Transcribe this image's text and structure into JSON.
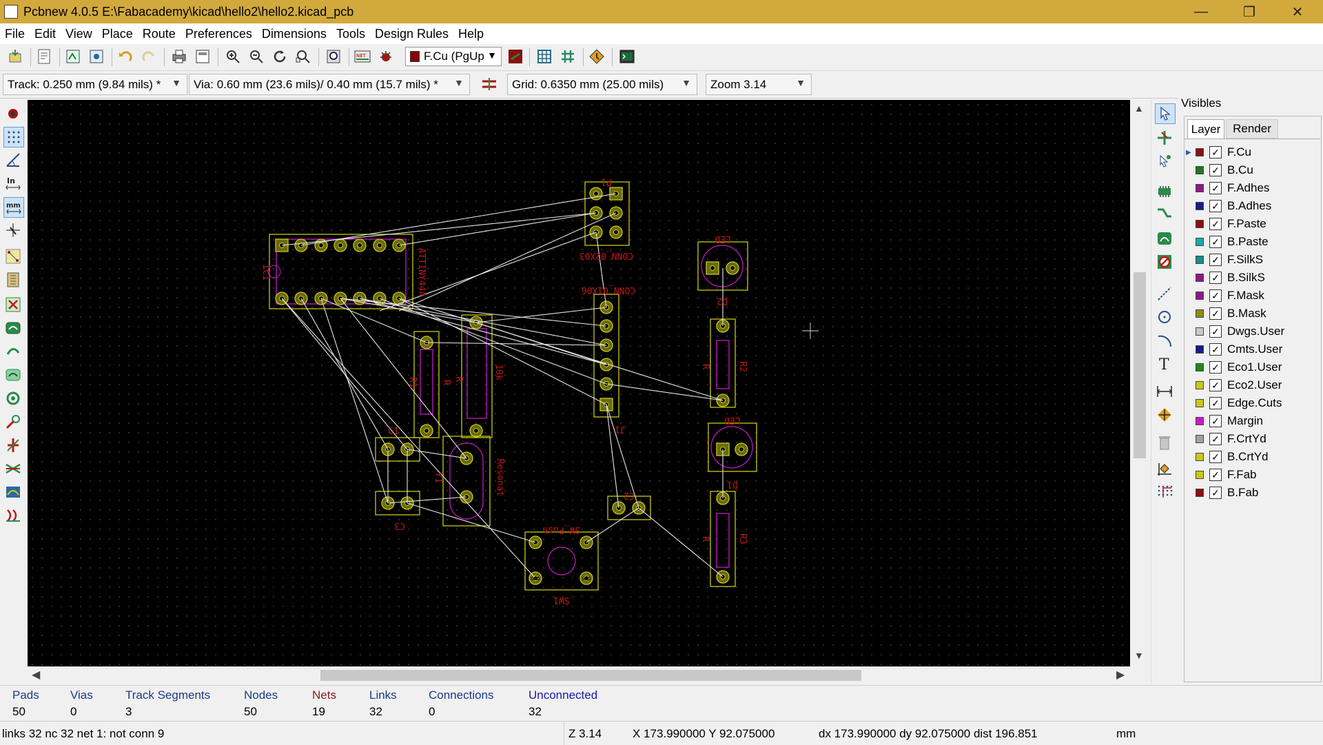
{
  "window": {
    "title": "Pcbnew 4.0.5 E:\\Fabacademy\\kicad\\hello2\\hello2.kicad_pcb",
    "minimize": "—",
    "maximize": "❐",
    "close": "✕"
  },
  "menu": [
    "File",
    "Edit",
    "View",
    "Place",
    "Route",
    "Preferences",
    "Dimensions",
    "Tools",
    "Design Rules",
    "Help"
  ],
  "toolbar": {
    "layer_select": "F.Cu (PgUp"
  },
  "auxbar": {
    "track": "Track: 0.250 mm (9.84 mils) *",
    "via": "Via: 0.60 mm (23.6 mils)/ 0.40 mm (15.7 mils) *",
    "grid": "Grid: 0.6350 mm (25.00 mils)",
    "zoom": "Zoom 3.14"
  },
  "canvas": {
    "refs": {
      "P1": "P1",
      "conn2x03": "CONN_02X03",
      "conn1x06": "CONN_01X06",
      "IC1": "IC1",
      "attiny": "ATTINY44A",
      "LED_top": "LED",
      "D2": "D2",
      "R2": "R2",
      "R_top": "R",
      "R1": "R1",
      "R_left": "R",
      "R_mid": "R",
      "R4": "10k",
      "LED_bot": "LED",
      "D1": "D1",
      "R3": "R3",
      "R_bot": "R",
      "C1": "C1",
      "C2": "C2",
      "C3": "C3",
      "Y1": "Y1",
      "resonator": "Resonat",
      "sw_push": "SW_Push",
      "SW1": "SW1",
      "J1": "J1",
      "GND1": "GND",
      "GND2": "GND"
    }
  },
  "visibles": {
    "title": "Visibles",
    "tabs": [
      "Layer",
      "Render"
    ],
    "layers": [
      {
        "name": "F.Cu",
        "color": "#8b1010"
      },
      {
        "name": "B.Cu",
        "color": "#1a7a1a"
      },
      {
        "name": "F.Adhes",
        "color": "#8b1a8b"
      },
      {
        "name": "B.Adhes",
        "color": "#1a1a8b"
      },
      {
        "name": "F.Paste",
        "color": "#8b1010"
      },
      {
        "name": "B.Paste",
        "color": "#1aaaaa"
      },
      {
        "name": "F.SilkS",
        "color": "#1a8b8b"
      },
      {
        "name": "B.SilkS",
        "color": "#8b1a8b"
      },
      {
        "name": "F.Mask",
        "color": "#8b1a8b"
      },
      {
        "name": "B.Mask",
        "color": "#8b8b1a"
      },
      {
        "name": "Dwgs.User",
        "color": "#c8c8c8"
      },
      {
        "name": "Cmts.User",
        "color": "#1a1a8b"
      },
      {
        "name": "Eco1.User",
        "color": "#1a8b1a"
      },
      {
        "name": "Eco2.User",
        "color": "#c8c81a"
      },
      {
        "name": "Edge.Cuts",
        "color": "#c8c81a"
      },
      {
        "name": "Margin",
        "color": "#c81ac8"
      },
      {
        "name": "F.CrtYd",
        "color": "#a0a0a0"
      },
      {
        "name": "B.CrtYd",
        "color": "#c8c81a"
      },
      {
        "name": "F.Fab",
        "color": "#c8c81a"
      },
      {
        "name": "B.Fab",
        "color": "#8b1010"
      }
    ]
  },
  "stats": [
    {
      "label": "Pads",
      "value": "50",
      "color": "#1a3a8a"
    },
    {
      "label": "Vias",
      "value": "0",
      "color": "#1a3a8a"
    },
    {
      "label": "Track Segments",
      "value": "3",
      "color": "#1a3a8a"
    },
    {
      "label": "Nodes",
      "value": "50",
      "color": "#1a3a8a"
    },
    {
      "label": "Nets",
      "value": "19",
      "color": "#8b1a1a"
    },
    {
      "label": "Links",
      "value": "32",
      "color": "#1a3a8a"
    },
    {
      "label": "Connections",
      "value": "0",
      "color": "#1a3a8a"
    },
    {
      "label": "Unconnected",
      "value": "32",
      "color": "#1a1aaa"
    }
  ],
  "statusline": {
    "message": "links 32 nc 32  net 1: not conn 9",
    "zoom": "Z 3.14",
    "xy": "X 173.990000  Y 92.075000",
    "delta": "dx 173.990000  dy 92.075000  dist 196.851",
    "units": "mm"
  }
}
